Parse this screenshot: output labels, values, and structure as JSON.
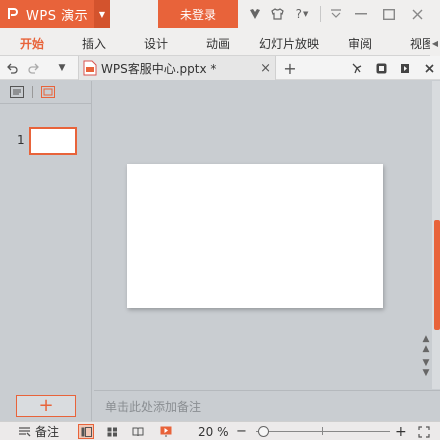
{
  "titlebar": {
    "app_name": "WPS 演示",
    "login_label": "未登录"
  },
  "ribbon": {
    "tabs": [
      "开始",
      "插入",
      "设计",
      "动画",
      "幻灯片放映",
      "审阅",
      "视图"
    ],
    "active_index": 0
  },
  "document": {
    "tab_title": "WPS客服中心.pptx *",
    "close_glyph": "×",
    "new_tab_glyph": "+"
  },
  "slides_pane": {
    "slide_number": "1",
    "add_glyph": "+"
  },
  "notes": {
    "placeholder": "单击此处添加备注"
  },
  "statusbar": {
    "notes_label": "备注",
    "zoom_label": "20 %",
    "zoom_minus": "−",
    "zoom_plus": "+",
    "zoom_percent": 20
  },
  "colors": {
    "accent": "#e8633a",
    "background": "#c9cdd1",
    "slide": "#ffffff"
  },
  "icons": [
    "wps-logo-icon",
    "dropdown-icon",
    "skin-icon",
    "shirt-icon",
    "help-icon",
    "ribbon-toggle-icon",
    "minimize-icon",
    "maximize-icon",
    "close-icon",
    "undo-icon",
    "redo-icon",
    "more-icon",
    "pptx-file-icon",
    "format-painter-icon",
    "slide-layout-icon",
    "play-icon",
    "more-tools-icon",
    "outline-view-icon",
    "slides-view-icon",
    "notes-icon",
    "normal-view-icon",
    "sorter-view-icon",
    "reading-view-icon",
    "slideshow-icon"
  ]
}
